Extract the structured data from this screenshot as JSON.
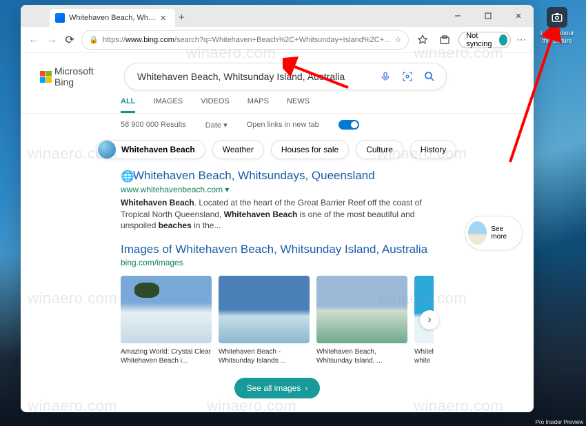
{
  "browser": {
    "tab_title": "Whitehaven Beach, Whitsund",
    "url_https": "https://",
    "url_host": "www.bing.com",
    "url_path": "/search?q=Whitehaven+Beach%2C+Whitsunday+Island%2C+...",
    "sync_label": "Not syncing"
  },
  "bing": {
    "logo_text": "Microsoft Bing",
    "query": "Whitehaven Beach, Whitsunday Island, Australia",
    "tabs": {
      "all": "ALL",
      "images": "IMAGES",
      "videos": "VIDEOS",
      "maps": "MAPS",
      "news": "NEWS"
    },
    "results_count": "58 900 000 Results",
    "date_label": "Date",
    "open_tab_label": "Open links in new tab",
    "entity_pill": "Whitehaven Beach",
    "related_pills": {
      "p1": "Weather",
      "p2": "Houses for sale",
      "p3": "Culture",
      "p4": "History"
    },
    "see_more": "See more"
  },
  "result1": {
    "title": "Whitehaven Beach, Whitsundays, Queensland",
    "url": "www.whitehavenbeach.com",
    "desc_prefix": "Whitehaven Beach",
    "desc_mid1": ". Located at the heart of the Great Barrier Reef off the coast of Tropical North Queensland, ",
    "desc_bold2": "Whitehaven Beach",
    "desc_mid2": " is one of the most beautiful and unspoiled ",
    "desc_bold3": "beaches",
    "desc_tail": " in the..."
  },
  "images_section": {
    "title": "Images of Whitehaven Beach, Whitsunday Island, Australia",
    "url": "bing.com/images",
    "cap1": "Amazing World: Crystal Clear Whitehaven Beach i...",
    "cap2": "Whitehaven Beach - Whitsunday Islands ...",
    "cap3": "Whitehaven Beach, Whitsunday Island, ...",
    "cap4": "Whitehaven white sa...",
    "see_all": "See all images"
  },
  "desktop_widget": {
    "line1": "Learn about",
    "line2": "this picture"
  },
  "taskbar": {
    "insider": "Pro Insider Preview"
  },
  "watermark": "winaero.com"
}
